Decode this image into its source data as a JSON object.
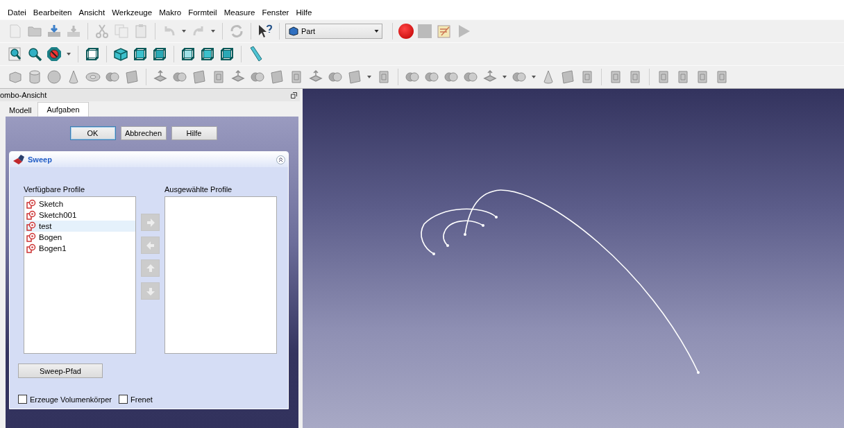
{
  "menu": [
    "Datei",
    "Bearbeiten",
    "Ansicht",
    "Werkzeuge",
    "Makro",
    "Formteil",
    "Measure",
    "Fenster",
    "Hilfe"
  ],
  "workbench": {
    "value": "Part"
  },
  "combo_view": {
    "title": "ombo-Ansicht",
    "tabs": [
      {
        "label": "Modell",
        "selected": false
      },
      {
        "label": "Aufgaben",
        "selected": true
      }
    ],
    "buttons": [
      {
        "label": "OK",
        "selected": true
      },
      {
        "label": "Abbrechen",
        "selected": false
      },
      {
        "label": "Hilfe",
        "selected": false
      }
    ]
  },
  "sweep": {
    "title": "Sweep",
    "available_label": "Verfügbare Profile",
    "selected_label": "Ausgewählte Profile",
    "available": [
      {
        "label": "Sketch",
        "selected": false
      },
      {
        "label": "Sketch001",
        "selected": false
      },
      {
        "label": "test",
        "selected": true
      },
      {
        "label": "Bogen",
        "selected": false
      },
      {
        "label": "Bogen1",
        "selected": false
      }
    ],
    "path_button": "Sweep-Pfad",
    "options": [
      {
        "label": "Erzeuge Volumenkörper",
        "checked": false
      },
      {
        "label": "Frenet",
        "checked": false
      }
    ]
  }
}
